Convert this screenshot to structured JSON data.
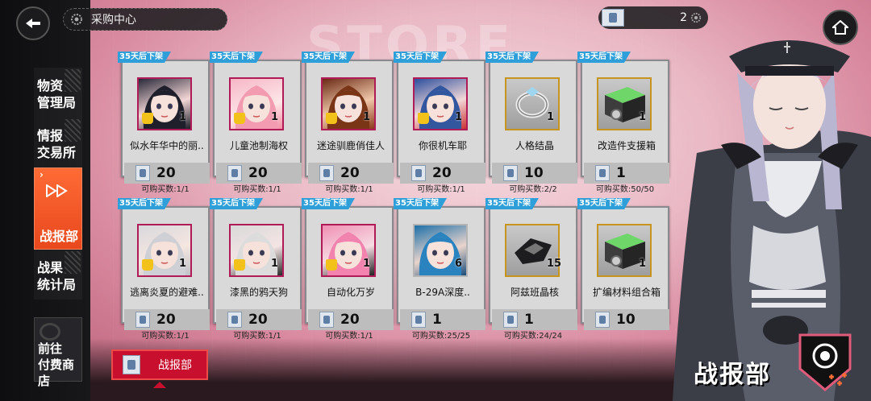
{
  "header": {
    "title": "采购中心",
    "currency_count": "2"
  },
  "sidebar": {
    "items": [
      {
        "label_line1": "物资",
        "label_line2": "管理局"
      },
      {
        "label_line1": "情报",
        "label_line2": "交易所"
      },
      {
        "label_line1": "战报部",
        "label_line2": ""
      },
      {
        "label_line1": "战果",
        "label_line2": "统计局"
      }
    ],
    "paid_shop": {
      "line1": "前往",
      "line2": "付费商店"
    }
  },
  "shop": {
    "badge": "35天后下架",
    "items": [
      {
        "name": "似水年华中的丽..",
        "qty": "1",
        "price": "20",
        "limit": "可购买数:1/1"
      },
      {
        "name": "儿童池制海权",
        "qty": "1",
        "price": "20",
        "limit": "可购买数:1/1"
      },
      {
        "name": "迷途驯鹿俏佳人",
        "qty": "1",
        "price": "20",
        "limit": "可购买数:1/1"
      },
      {
        "name": "你很机车耶",
        "qty": "1",
        "price": "20",
        "limit": "可购买数:1/1"
      },
      {
        "name": "人格结晶",
        "qty": "1",
        "price": "10",
        "limit": "可购买数:2/2"
      },
      {
        "name": "改造件支援箱",
        "qty": "1",
        "price": "1",
        "limit": "可购买数:50/50"
      },
      {
        "name": "逃离炎夏的避难..",
        "qty": "1",
        "price": "20",
        "limit": "可购买数:1/1"
      },
      {
        "name": "漆黑的鸦天狗",
        "qty": "1",
        "price": "20",
        "limit": "可购买数:1/1"
      },
      {
        "name": "自动化万岁",
        "qty": "1",
        "price": "20",
        "limit": "可购买数:1/1"
      },
      {
        "name": "B-29A深度..",
        "qty": "6",
        "price": "1",
        "limit": "可购买数:25/25"
      },
      {
        "name": "阿兹班晶核",
        "qty": "15",
        "price": "1",
        "limit": "可购买数:24/24"
      },
      {
        "name": "扩编材料组合箱",
        "qty": "1",
        "price": "10",
        "limit": ""
      }
    ]
  },
  "category_button": {
    "label": "战报部"
  },
  "character_panel": {
    "title": "战报部"
  },
  "colors": {
    "accent_orange": "#e8481d",
    "badge_blue": "#2e9fd8",
    "button_red": "#c8102e",
    "frame_pink": "#b01a57"
  }
}
